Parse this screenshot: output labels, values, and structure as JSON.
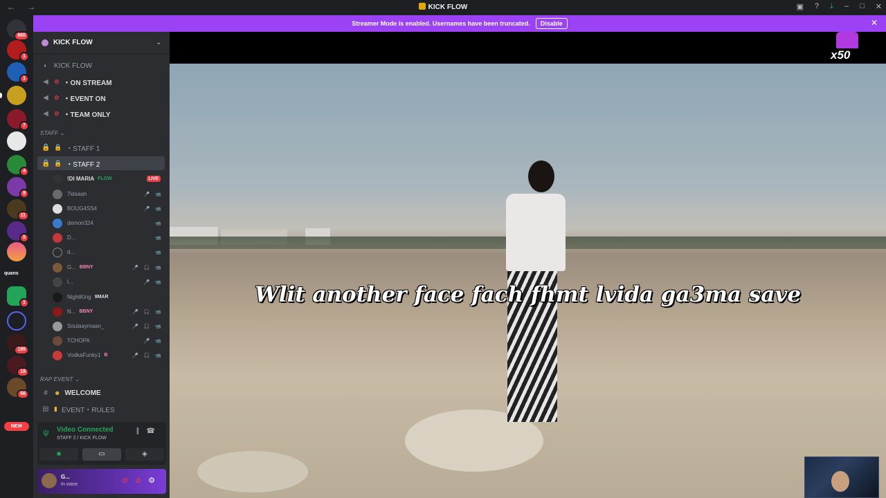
{
  "window": {
    "title": "KICK FLOW",
    "nav_back": "←",
    "nav_forward": "→"
  },
  "servers": {
    "items": [
      {
        "name": "Direct Messages",
        "badge": "860"
      },
      {
        "name": "server-2",
        "badge": "1"
      },
      {
        "name": "server-3",
        "badge": "1"
      },
      {
        "name": "KICK FLOW",
        "badge": ""
      },
      {
        "name": "server-5",
        "badge": "7"
      },
      {
        "name": "server-6",
        "badge": ""
      },
      {
        "name": "server-7",
        "badge": "4"
      },
      {
        "name": "server-8",
        "badge": "8"
      },
      {
        "name": "server-9",
        "badge": "11"
      },
      {
        "name": "server-10",
        "badge": "5"
      },
      {
        "name": "server-11",
        "badge": ""
      },
      {
        "name": "server-13",
        "badge": "1"
      },
      {
        "name": "server-14",
        "badge": ""
      },
      {
        "name": "server-15",
        "badge": "195"
      },
      {
        "name": "server-16",
        "badge": "18"
      },
      {
        "name": "server-17",
        "badge": "56"
      }
    ],
    "text_label": "quans",
    "new_label": "NEW"
  },
  "banner": {
    "text": "Streamer Mode is enabled. Usernames have been truncated.",
    "button": "Disable",
    "close": "✕"
  },
  "guild": {
    "name": "KICK FLOW",
    "chevron": "⌄"
  },
  "channels": {
    "top": [
      {
        "label": "KICK FLOW"
      },
      {
        "label": "・ON STREAM"
      },
      {
        "label": "・EVENT ON"
      },
      {
        "label": "・TEAM ONLY"
      }
    ],
    "staff_category": "STAFF ⌄",
    "staff": [
      {
        "label": "・STAFF 1"
      },
      {
        "label": "・STAFF 2"
      }
    ],
    "voice_users": [
      {
        "name": "!DI MARIA",
        "tag": "FLOW",
        "live": "LIVE"
      },
      {
        "name": "7idaaan",
        "tag": "",
        "status": "🎤 📹"
      },
      {
        "name": "BOUG4SS4",
        "tag": "",
        "status": "🎤 📹"
      },
      {
        "name": "demon324",
        "tag": "",
        "status": "📹"
      },
      {
        "name": "D...",
        "tag": "",
        "status": "📹"
      },
      {
        "name": "d...",
        "tag": "",
        "status": "📹"
      },
      {
        "name": "G...",
        "tag": "BBNY",
        "status": "🎤 🎧 📹"
      },
      {
        "name": "l...",
        "tag": "",
        "status": "🎤 📹"
      },
      {
        "name": "NightKing",
        "tag": "9MAR",
        "status": ""
      },
      {
        "name": "N...",
        "tag": "BBNY",
        "status": "🎤 🎧 📹"
      },
      {
        "name": "Soulaaymaan_",
        "tag": "",
        "status": "🎤 🎧 📹"
      },
      {
        "name": "TCHOPA",
        "tag": "",
        "status": "🎤 📹"
      },
      {
        "name": "VodkaFunky1",
        "tag": "B",
        "status": "🎤 🎧 📹"
      }
    ],
    "rap_category": "RAP EVENT ⌄",
    "rap": [
      {
        "label": "WELCOME"
      },
      {
        "label": "EVENT・RULES"
      }
    ]
  },
  "voice_panel": {
    "status": "Video Connected",
    "location": "STAFF 2 / KICK FLOW"
  },
  "user": {
    "name": "G...",
    "status": "In voice"
  },
  "stream": {
    "caption": "Wlit another face fach fhmt lvida ga3ma save",
    "overlay_text": "x50"
  },
  "colors": {
    "banner": "#9b42f5",
    "live": "#f23f43",
    "connected": "#23a559"
  }
}
